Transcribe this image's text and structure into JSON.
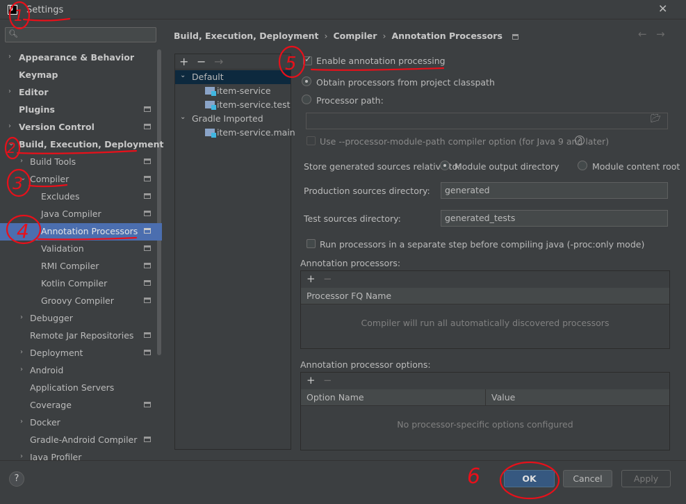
{
  "window": {
    "title": "Settings",
    "close_glyph": "✕"
  },
  "search": {
    "placeholder": "",
    "icon_glyph": "🔍︎"
  },
  "sidebar": {
    "items": [
      {
        "label": "Appearance & Behavior"
      },
      {
        "label": "Keymap"
      },
      {
        "label": "Editor"
      },
      {
        "label": "Plugins"
      },
      {
        "label": "Version Control"
      },
      {
        "label": "Build, Execution, Deployment"
      },
      {
        "label": "Build Tools"
      },
      {
        "label": "Compiler"
      },
      {
        "label": "Excludes"
      },
      {
        "label": "Java Compiler"
      },
      {
        "label": "Annotation Processors"
      },
      {
        "label": "Validation"
      },
      {
        "label": "RMI Compiler"
      },
      {
        "label": "Kotlin Compiler"
      },
      {
        "label": "Groovy Compiler"
      },
      {
        "label": "Debugger"
      },
      {
        "label": "Remote Jar Repositories"
      },
      {
        "label": "Deployment"
      },
      {
        "label": "Android"
      },
      {
        "label": "Application Servers"
      },
      {
        "label": "Coverage"
      },
      {
        "label": "Docker"
      },
      {
        "label": "Gradle-Android Compiler"
      },
      {
        "label": "Java Profiler"
      }
    ]
  },
  "breadcrumb": {
    "part1": "Build, Execution, Deployment",
    "sep": "›",
    "part2": "Compiler",
    "part3": "Annotation Processors"
  },
  "nav": {
    "back": "←",
    "forward": "→"
  },
  "profiles": {
    "toolbar": {
      "add": "+",
      "remove": "−",
      "move": "→"
    },
    "nodes": [
      {
        "label": "Default"
      },
      {
        "label": "item-service"
      },
      {
        "label": "item-service.test"
      },
      {
        "label": "Gradle Imported"
      },
      {
        "label": "item-service.main"
      }
    ]
  },
  "form": {
    "enable_label": "Enable annotation processing",
    "obtain_label": "Obtain processors from project classpath",
    "path_label": "Processor path:",
    "path_value": "",
    "module_path_label": "Use --processor-module-path compiler option (for Java 9 and later)",
    "help_glyph": "?",
    "store_label": "Store generated sources relative to:",
    "module_output_label": "Module output directory",
    "module_content_label": "Module content root",
    "prod_dir_label": "Production sources directory:",
    "prod_dir_value": "generated",
    "test_dir_label": "Test sources directory:",
    "test_dir_value": "generated_tests",
    "separate_step_label": "Run processors in a separate step before compiling java (-proc:only mode)",
    "processors_title": "Annotation processors:",
    "processors_col": "Processor FQ Name",
    "processors_empty": "Compiler will run all automatically discovered processors",
    "options_title": "Annotation processor options:",
    "options_col1": "Option Name",
    "options_col2": "Value",
    "options_empty": "No processor-specific options configured",
    "add": "+",
    "remove": "−"
  },
  "buttons": {
    "help": "?",
    "ok": "OK",
    "cancel": "Cancel",
    "apply": "Apply"
  },
  "annotations": {
    "n1": "1",
    "n2": "2",
    "n3": "3",
    "n4": "4",
    "n5": "5",
    "n6": "6"
  },
  "colors": {
    "annotation_red": "#e8101a",
    "selection": "#4b6eaf",
    "primary_button": "#365880"
  }
}
